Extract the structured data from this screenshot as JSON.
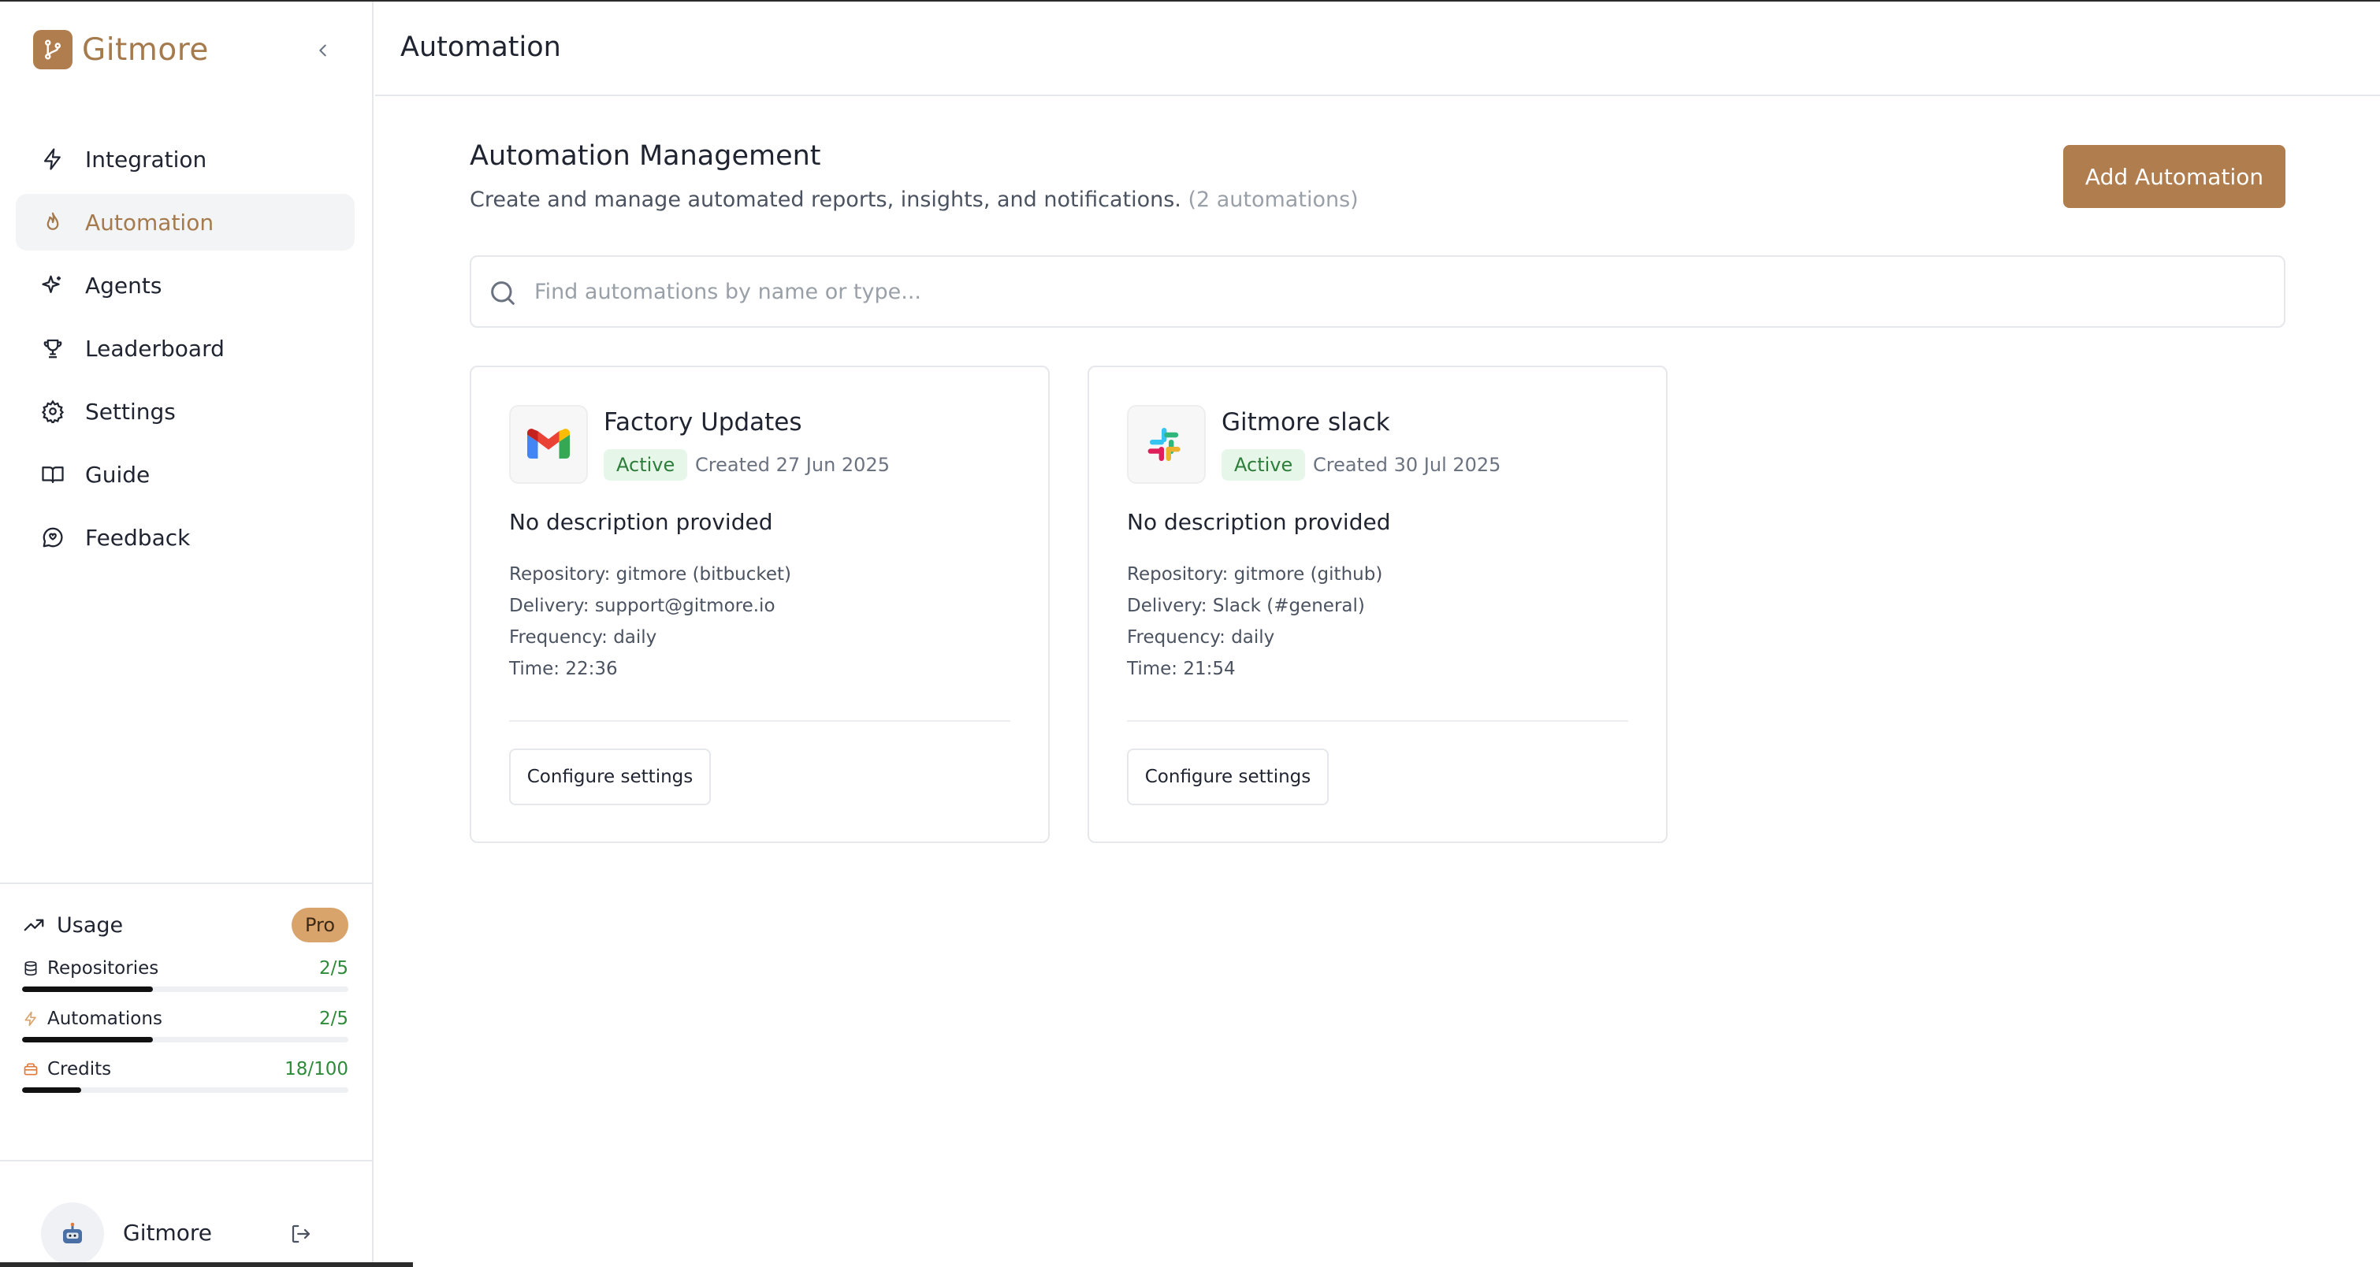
{
  "app": {
    "name": "Gitmore"
  },
  "sidebar": {
    "items": [
      {
        "label": "Integration",
        "icon": "lightning-icon"
      },
      {
        "label": "Automation",
        "icon": "flame-icon",
        "active": true
      },
      {
        "label": "Agents",
        "icon": "sparkles-icon"
      },
      {
        "label": "Leaderboard",
        "icon": "trophy-icon"
      },
      {
        "label": "Settings",
        "icon": "gear-icon"
      },
      {
        "label": "Guide",
        "icon": "book-icon"
      },
      {
        "label": "Feedback",
        "icon": "chat-icon"
      }
    ]
  },
  "usage": {
    "title": "Usage",
    "plan": "Pro",
    "rows": [
      {
        "label": "Repositories",
        "value": "2/5",
        "fraction": 0.4
      },
      {
        "label": "Automations",
        "value": "2/5",
        "fraction": 0.4
      },
      {
        "label": "Credits",
        "value": "18/100",
        "fraction": 0.18
      }
    ]
  },
  "profile": {
    "name": "Gitmore"
  },
  "header": {
    "title": "Automation"
  },
  "main": {
    "title": "Automation Management",
    "subtitle": "Create and manage automated reports, insights, and notifications.",
    "count": "(2 automations)",
    "add_button": "Add Automation",
    "search_placeholder": "Find automations by name or type..."
  },
  "cards": [
    {
      "title": "Factory Updates",
      "icon": "gmail-icon",
      "status": "Active",
      "created": "Created 27 Jun 2025",
      "description": "No description provided",
      "repository": "Repository: gitmore (bitbucket)",
      "delivery": "Delivery: support@gitmore.io",
      "frequency": "Frequency: daily",
      "time": "Time: 22:36",
      "button": "Configure settings"
    },
    {
      "title": "Gitmore slack",
      "icon": "slack-icon",
      "status": "Active",
      "created": "Created 30 Jul 2025",
      "description": "No description provided",
      "repository": "Repository: gitmore (github)",
      "delivery": "Delivery: Slack (#general)",
      "frequency": "Frequency: daily",
      "time": "Time: 21:54",
      "button": "Configure settings"
    }
  ],
  "colors": {
    "brand": "#b07d4f",
    "accent_text": "#a57a4c",
    "success": "#2e8b3a",
    "badge_bg": "#e6f6e9"
  }
}
